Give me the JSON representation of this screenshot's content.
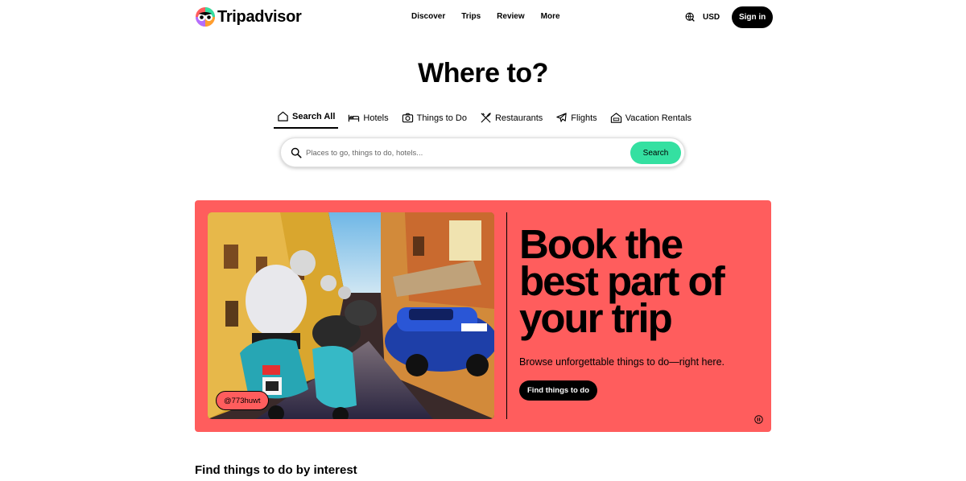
{
  "brand": {
    "name": "Tripadvisor"
  },
  "nav": {
    "items": [
      "Discover",
      "Trips",
      "Review",
      "More"
    ]
  },
  "header": {
    "currency": "USD",
    "signin_label": "Sign in"
  },
  "hero": {
    "title": "Where to?"
  },
  "tabs": [
    {
      "label": "Search All",
      "icon": "home-icon",
      "active": true
    },
    {
      "label": "Hotels",
      "icon": "bed-icon"
    },
    {
      "label": "Things to Do",
      "icon": "camera-icon"
    },
    {
      "label": "Restaurants",
      "icon": "fork-knife-icon"
    },
    {
      "label": "Flights",
      "icon": "plane-icon"
    },
    {
      "label": "Vacation Rentals",
      "icon": "house-icon"
    }
  ],
  "search": {
    "placeholder": "Places to go, things to do, hotels...",
    "value": "",
    "button_label": "Search"
  },
  "banner": {
    "headline": "Book the best part of your trip",
    "subline": "Browse unforgettable things to do—right here.",
    "cta_label": "Find things to do",
    "photo_credit": "@773huwt",
    "background_color": "#ff5d5d"
  },
  "section": {
    "title": "Find things to do by interest"
  },
  "colors": {
    "accent": "#34e0a1",
    "banner": "#ff5d5d",
    "text": "#000000"
  }
}
